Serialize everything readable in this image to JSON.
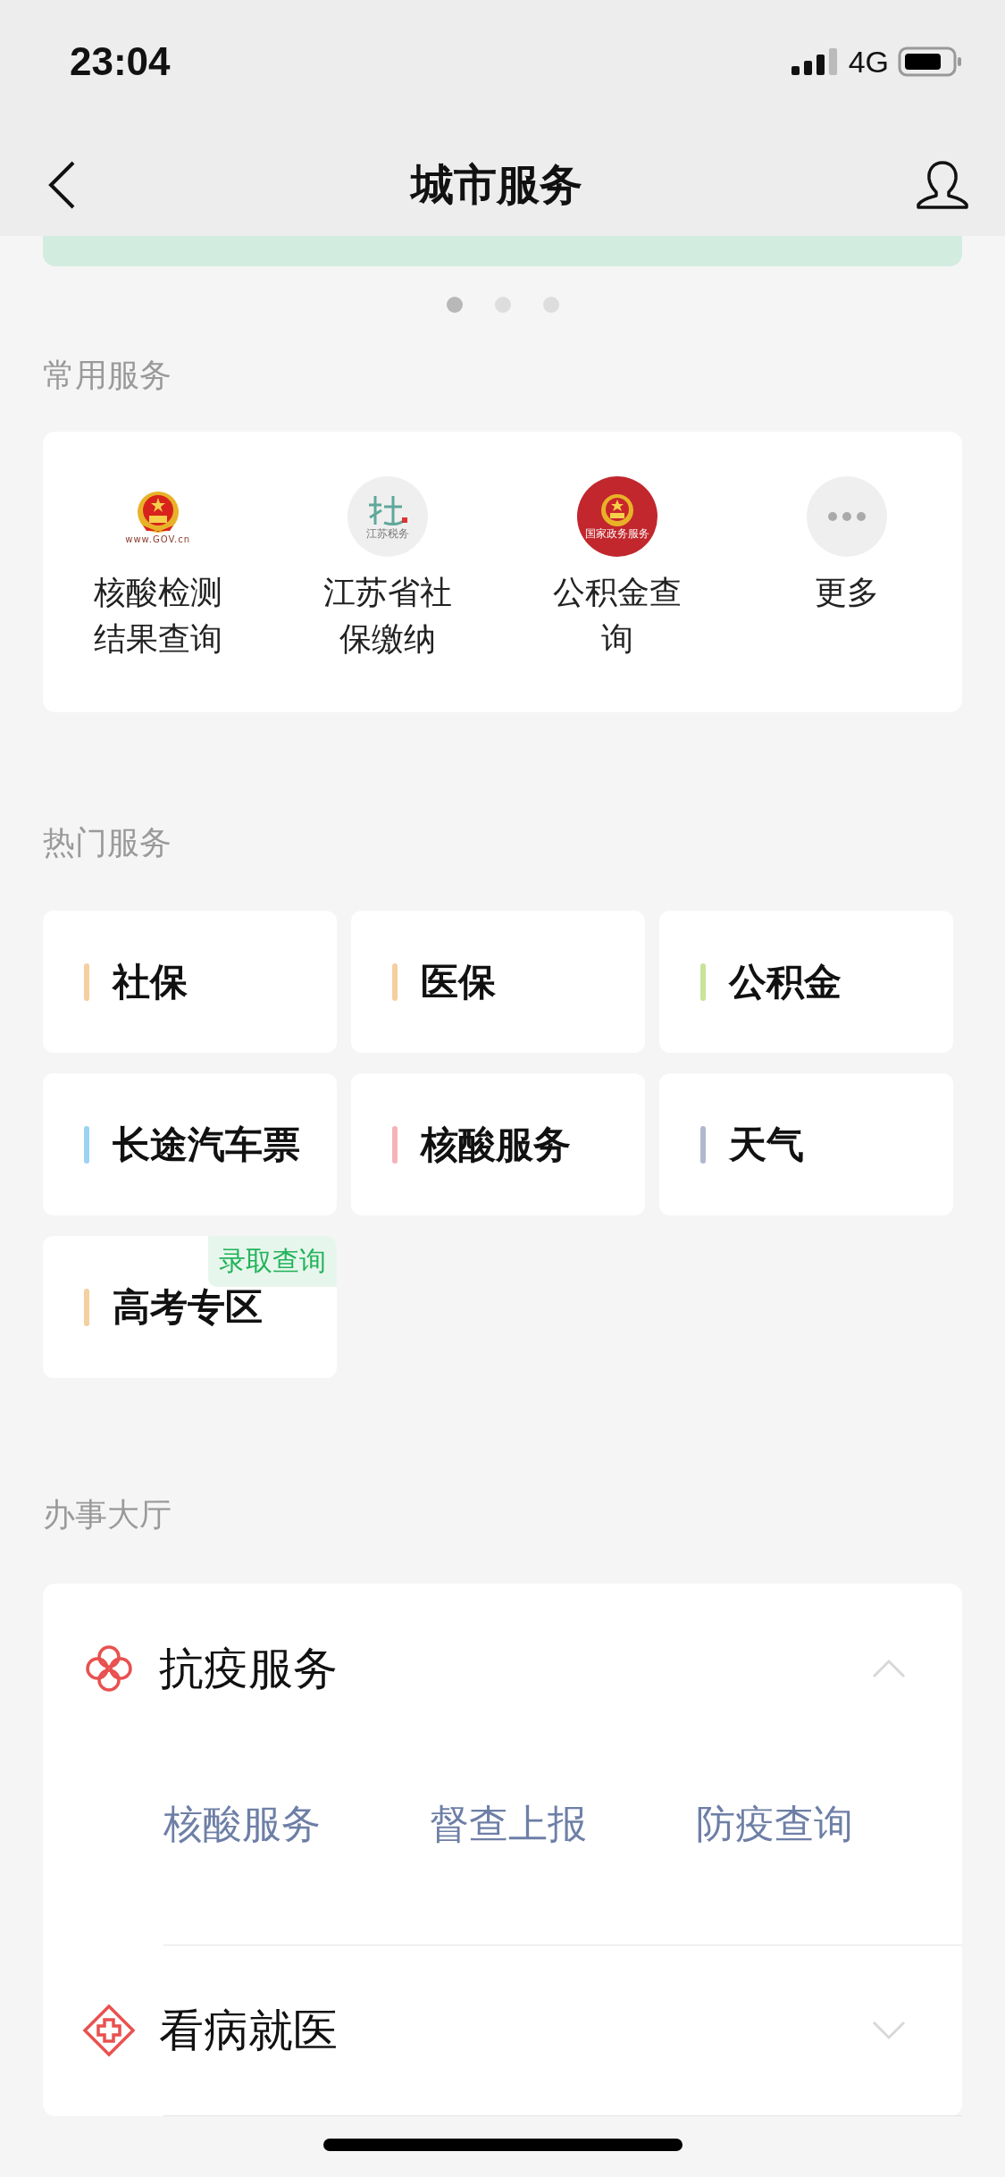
{
  "status_bar": {
    "time": "23:04",
    "network": "4G"
  },
  "nav": {
    "title": "城市服务"
  },
  "banner": {
    "dots": [
      {
        "selected": true
      },
      {
        "selected": false
      },
      {
        "selected": false
      }
    ]
  },
  "common_services": {
    "title": "常用服务",
    "items": [
      {
        "kind": "emblem",
        "caption": "www.GOV.cn",
        "label": "核酸检测结果查询"
      },
      {
        "kind": "social",
        "caption": "江苏税务",
        "label": "江苏省社保缴纳"
      },
      {
        "kind": "gov_service",
        "caption": "国家政务服务",
        "label": "公积金查询"
      },
      {
        "kind": "more",
        "label": "更多"
      }
    ]
  },
  "hot_services": {
    "title": "热门服务",
    "items": [
      {
        "label": "社保",
        "color": "#f5cfa0"
      },
      {
        "label": "医保",
        "color": "#f5cfa0"
      },
      {
        "label": "公积金",
        "color": "#c8e39a"
      },
      {
        "label": "长途汽车票",
        "color": "#9cd3f2"
      },
      {
        "label": "核酸服务",
        "color": "#f5b3b8"
      },
      {
        "label": "天气",
        "color": "#b0b8cf"
      },
      {
        "label": "高考专区",
        "color": "#f5cfa0",
        "tag": "录取查询"
      }
    ]
  },
  "service_hall": {
    "title": "办事大厅",
    "sections": [
      {
        "kind": "clover",
        "title": "抗疫服务",
        "expanded": true,
        "links": [
          "核酸服务",
          "督查上报",
          "防疫查询"
        ]
      },
      {
        "kind": "cross",
        "title": "看病就医",
        "expanded": false
      }
    ]
  }
}
